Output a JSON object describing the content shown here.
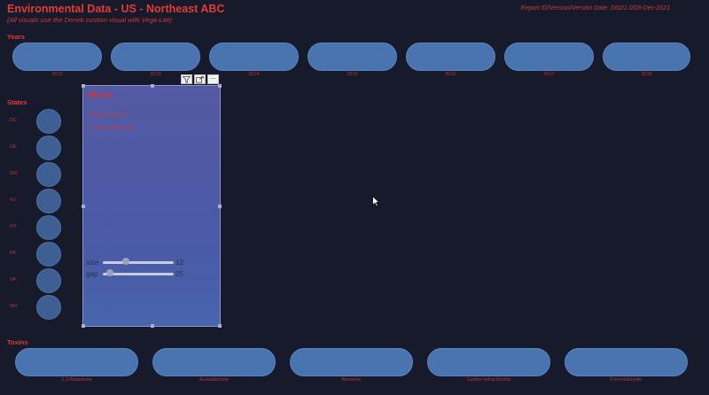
{
  "header": {
    "title": "Environmental Data - US - Northeast ABC",
    "subtitle": "(All visuals use the Deneb custom visual with Vega-Lite)",
    "report_id": "Report ID/Version/Version Date: D02/1.0/09-Dec-2021"
  },
  "years": {
    "label": "Years",
    "items": [
      "2012",
      "2013",
      "2014",
      "2015",
      "2016",
      "2017",
      "2018"
    ]
  },
  "states": {
    "label": "States",
    "items": [
      "DC",
      "DE",
      "MD",
      "NJ",
      "NY",
      "PA",
      "VA",
      "WV"
    ]
  },
  "visual": {
    "title": "Mexico",
    "line1": "Selected Year: All",
    "line2": "Selected State: DE",
    "sliders": [
      {
        "name": "size",
        "value": "12",
        "level": 0.3
      },
      {
        "name": "gap",
        "value": "25",
        "level": 0.05
      }
    ],
    "toolbar": {
      "filter_icon": "filter-icon",
      "focus_icon": "focus-mode-icon",
      "more_icon": "more-options-icon"
    }
  },
  "toxins": {
    "label": "Toxins",
    "items": [
      "1,3-Butadiene",
      "Acetaldehyde",
      "Benzene",
      "Carbon tetrachloride",
      "Formaldehyde"
    ]
  },
  "colors": {
    "background": "#161a2b",
    "accent_red": "#e23b34",
    "button_blue": "#4a74b0"
  }
}
